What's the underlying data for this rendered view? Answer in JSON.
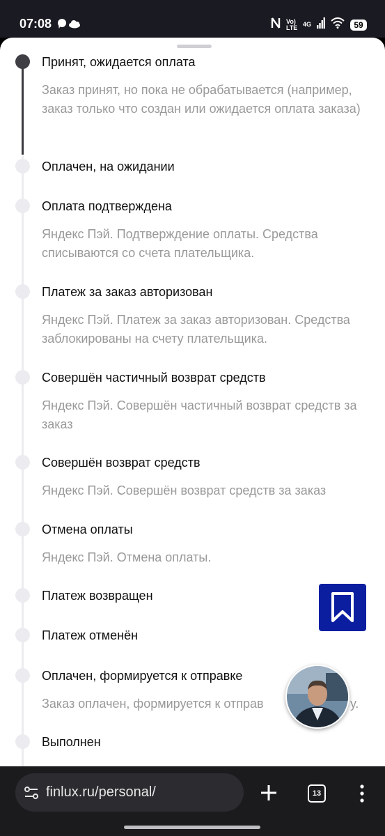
{
  "status_bar": {
    "time": "07:08",
    "battery": "59",
    "network": "4G",
    "volte": "Vo) LTE",
    "icons": [
      "chat-icon",
      "cloud-icon",
      "nfc-icon",
      "signal-icon",
      "wifi-icon",
      "battery-icon"
    ]
  },
  "timeline": {
    "items": [
      {
        "title": "Принят, ожидается оплата",
        "description": "Заказ принят, но пока не обрабатывается (например, заказ только что создан или ожидается оплата заказа)",
        "active": true
      },
      {
        "title": "Оплачен, на ожидании",
        "description": ""
      },
      {
        "title": "Оплата подтверждена",
        "description": "Яндекс Пэй. Подтверждение оплаты. Средства списываются со счета плательщика."
      },
      {
        "title": "Платеж за заказ авторизован",
        "description": "Яндекс Пэй. Платеж за заказ авторизован. Средства заблокированы на счету плательщика."
      },
      {
        "title": "Совершён частичный возврат средств",
        "description": "Яндекс Пэй. Совершён частичный возврат средств за заказ"
      },
      {
        "title": "Совершён возврат средств",
        "description": "Яндекс Пэй. Совершён возврат средств за заказ"
      },
      {
        "title": "Отмена оплаты",
        "description": "Яндекс Пэй. Отмена оплаты."
      },
      {
        "title": "Платеж возвращен",
        "description": ""
      },
      {
        "title": "Платеж отменён",
        "description": ""
      },
      {
        "title": "Оплачен, формируется к отправке",
        "description": "Заказ оплачен, формируется к отправ",
        "description_tail": "у."
      },
      {
        "title": "Выполнен",
        "description": ""
      }
    ]
  },
  "floating": {
    "bookmark_icon": "bookmark-icon",
    "bookmark_color": "#0b1ea0"
  },
  "browser": {
    "url": "finlux.ru/personal/",
    "tab_count": "13"
  }
}
